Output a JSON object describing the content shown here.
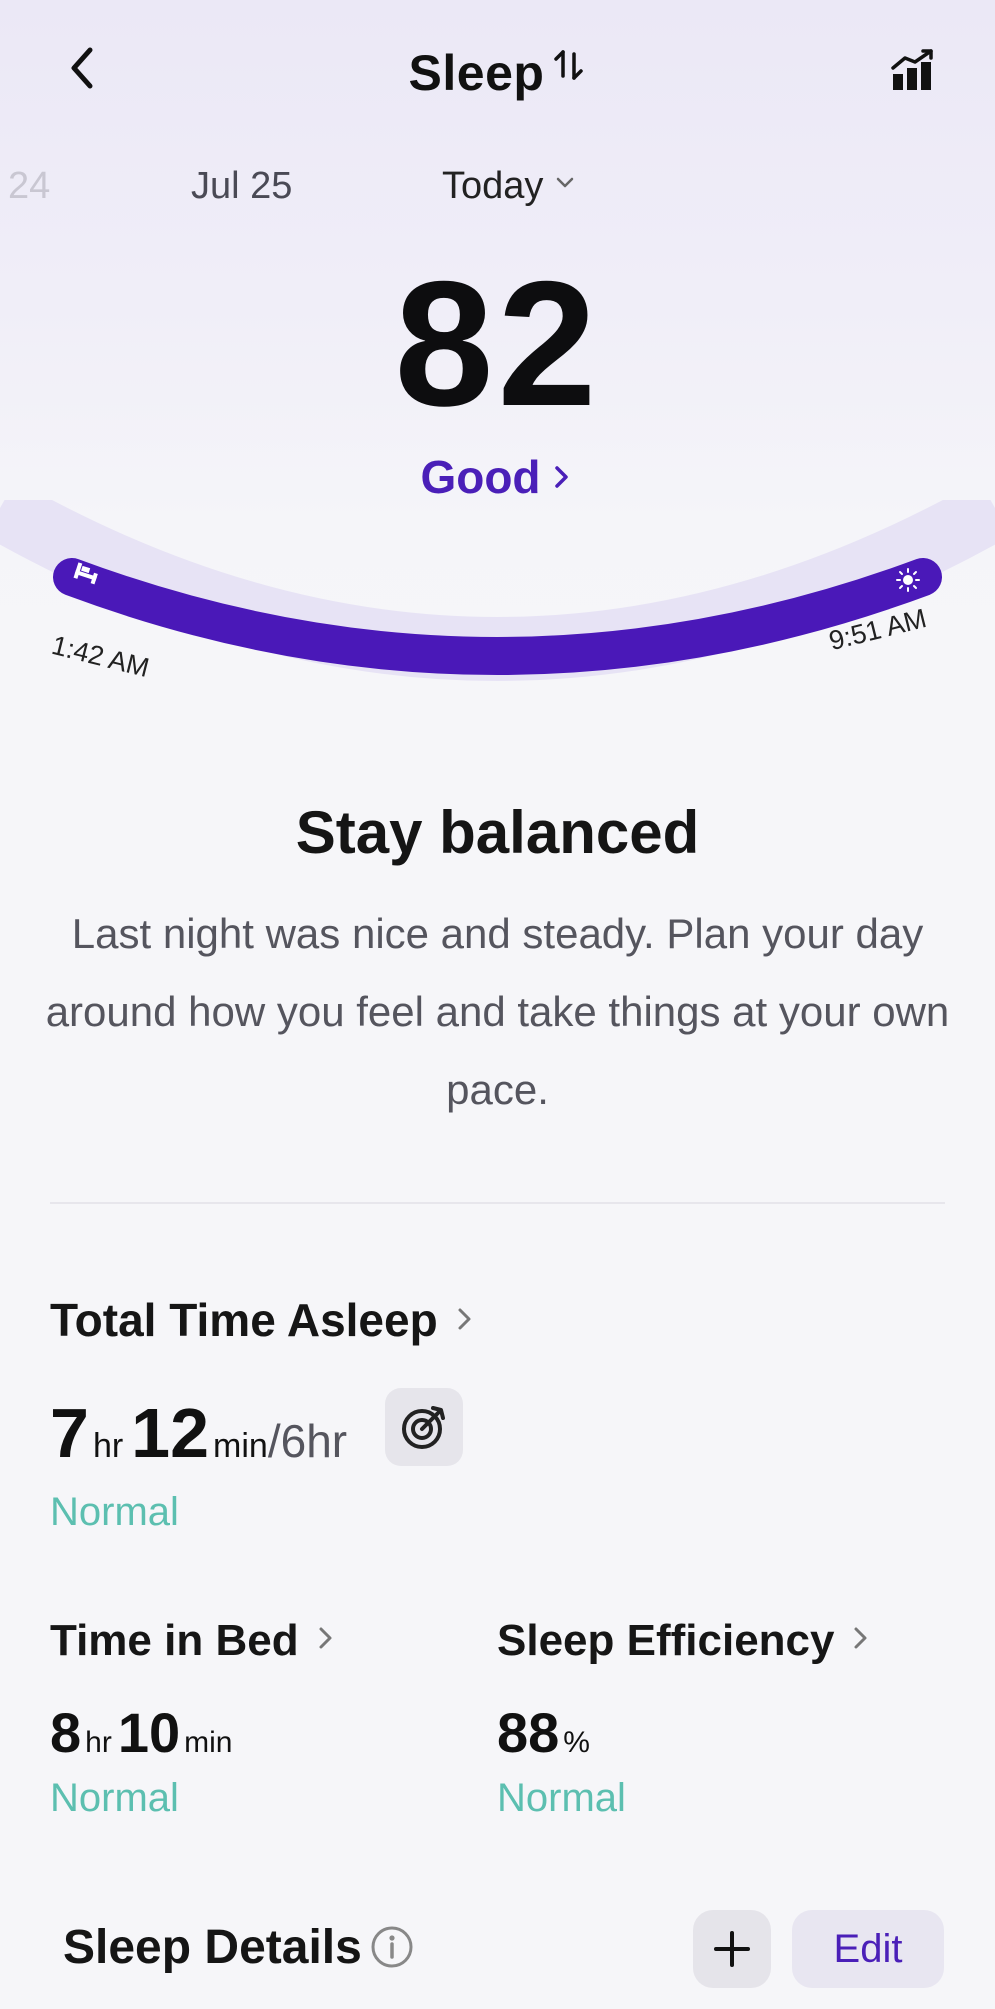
{
  "header": {
    "title": "Sleep",
    "back_icon": "chevron-left-icon",
    "swap_icon": "sort-arrows-icon",
    "trend_icon": "bar-chart-trend-icon"
  },
  "date_strip": {
    "previous": "24",
    "middle": "Jul 25",
    "selected": "Today"
  },
  "score": {
    "value": "82",
    "rating": "Good"
  },
  "sleep_timeline": {
    "start": "1:42 AM",
    "end": "9:51 AM",
    "bar_color": "#4a18b8",
    "start_icon": "bed-icon",
    "end_icon": "sun-icon"
  },
  "insight": {
    "title": "Stay balanced",
    "body": "Last night was nice and steady. Plan your day around how you feel and take things at your own pace."
  },
  "total_time_asleep": {
    "label": "Total Time Asleep",
    "hours": "7",
    "hours_unit": "hr",
    "minutes": "12",
    "minutes_unit": "min",
    "goal": "/6hr",
    "status": "Normal"
  },
  "time_in_bed": {
    "label": "Time in Bed",
    "hours": "8",
    "hours_unit": "hr",
    "minutes": "10",
    "minutes_unit": "min",
    "status": "Normal"
  },
  "sleep_efficiency": {
    "label": "Sleep Efficiency",
    "value": "88",
    "unit": "%",
    "status": "Normal"
  },
  "sleep_details": {
    "label": "Sleep Details",
    "add_label": "+",
    "edit_label": "Edit"
  },
  "colors": {
    "accent": "#4a1fb8",
    "status_normal": "#5cbfb0"
  }
}
